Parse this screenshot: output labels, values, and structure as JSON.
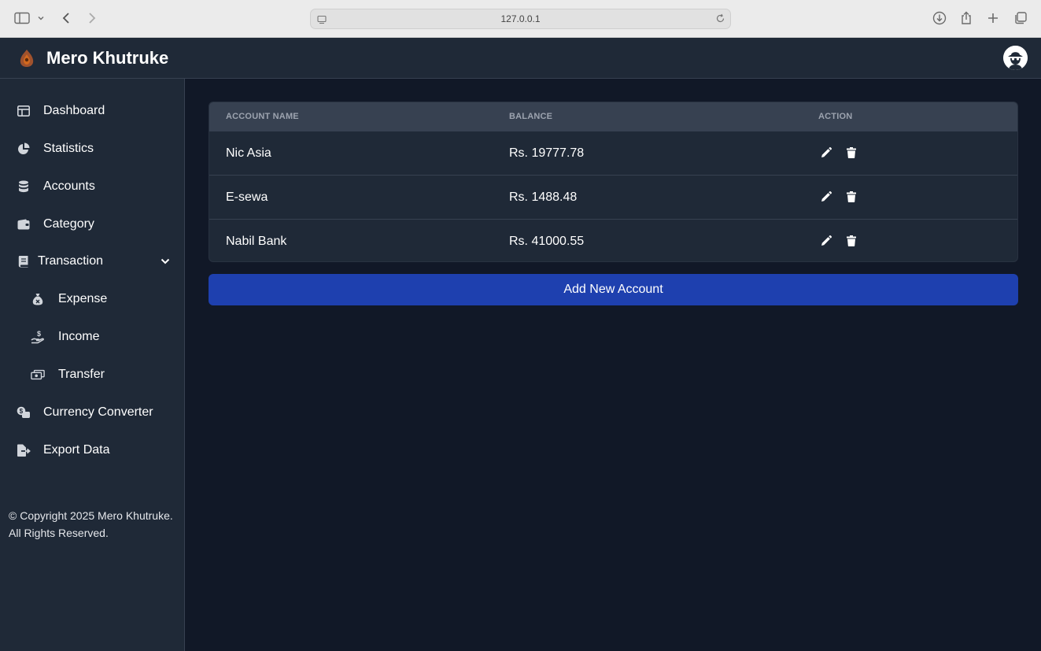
{
  "browser": {
    "url": "127.0.0.1",
    "icons": [
      "sidebar-toggle-icon",
      "chevron-down-icon",
      "back-icon",
      "forward-icon",
      "site-icon",
      "reload-icon",
      "download-icon",
      "share-icon",
      "new-tab-icon",
      "tabs-overview-icon"
    ]
  },
  "header": {
    "brand": "Mero Khutruke"
  },
  "sidebar": {
    "items": [
      {
        "label": "Dashboard",
        "icon": "dashboard-icon"
      },
      {
        "label": "Statistics",
        "icon": "pie-chart-icon"
      },
      {
        "label": "Accounts",
        "icon": "database-icon"
      },
      {
        "label": "Category",
        "icon": "wallet-icon"
      },
      {
        "label": "Transaction",
        "icon": "book-icon"
      },
      {
        "label": "Expense",
        "icon": "money-bag-icon"
      },
      {
        "label": "Income",
        "icon": "hand-coin-icon"
      },
      {
        "label": "Transfer",
        "icon": "money-transfer-icon"
      },
      {
        "label": "Currency Converter",
        "icon": "currency-exchange-icon"
      },
      {
        "label": "Export Data",
        "icon": "file-export-icon"
      }
    ],
    "copyright": "© Copyright 2025 Mero Khutruke. All Rights Reserved."
  },
  "table": {
    "headers": [
      "ACCOUNT NAME",
      "BALANCE",
      "ACTION"
    ],
    "rows": [
      {
        "name": "Nic Asia",
        "balance": "Rs. 19777.78"
      },
      {
        "name": "E-sewa",
        "balance": "Rs. 1488.48"
      },
      {
        "name": "Nabil Bank",
        "balance": "Rs. 41000.55"
      }
    ]
  },
  "add_button": "Add New Account",
  "colors": {
    "background": "#111827",
    "panel": "#1f2937",
    "table_header": "#374151",
    "accent": "#1e40af"
  }
}
